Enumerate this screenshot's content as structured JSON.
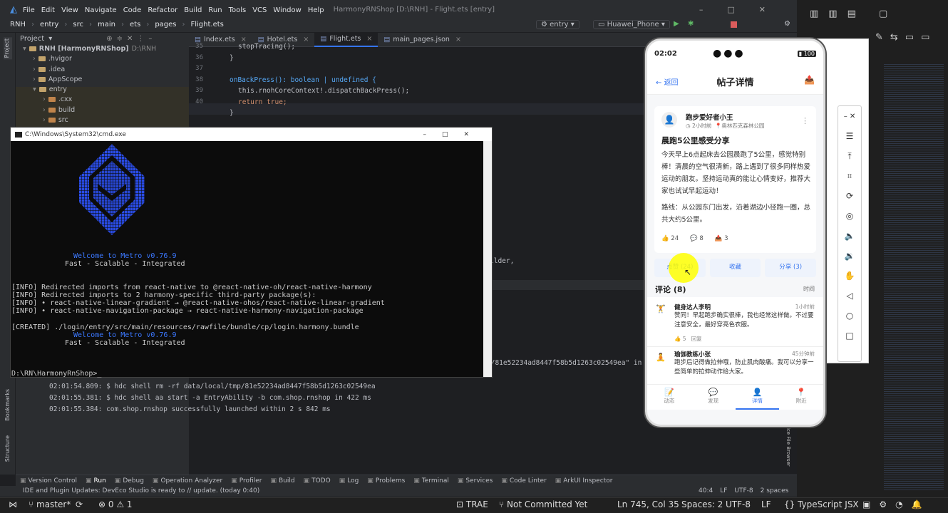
{
  "ide": {
    "title": "HarmonyRNShop [D:\\RNH] - Flight.ets [entry]",
    "menu": [
      "File",
      "Edit",
      "View",
      "Navigate",
      "Code",
      "Refactor",
      "Build",
      "Run",
      "Tools",
      "VCS",
      "Window",
      "Help"
    ],
    "breadcrumb": [
      "RNH",
      "entry",
      "src",
      "main",
      "ets",
      "pages",
      "Flight.ets"
    ],
    "run_config": "entry",
    "device": "Huawei_Phone",
    "project_label": "Project",
    "tree": [
      {
        "label": "RNH [HarmonyRNShop]",
        "extra": "D:\\RNH",
        "depth": 0
      },
      {
        "label": ".hvigor",
        "depth": 1
      },
      {
        "label": ".idea",
        "depth": 1
      },
      {
        "label": "AppScope",
        "depth": 1
      },
      {
        "label": "entry",
        "depth": 1
      },
      {
        "label": ".cxx",
        "depth": 2
      },
      {
        "label": "build",
        "depth": 2
      },
      {
        "label": "src",
        "depth": 2
      }
    ],
    "tabs": [
      "Index.ets",
      "Hotel.ets",
      "Flight.ets",
      "main_pages.json"
    ],
    "code_lines": [
      {
        "n": "35",
        "text": "stopTracing();"
      },
      {
        "n": "36",
        "text": "}"
      },
      {
        "n": "37",
        "text": ""
      },
      {
        "n": "38",
        "text": "onBackPress(): boolean | undefined {"
      },
      {
        "n": "39",
        "text": "this.rnohCoreContext!.dispatchBackPress();"
      },
      {
        "n": "40",
        "text": "return true;"
      },
      {
        "n": "41",
        "text": "}"
      }
    ],
    "right_snippet": "ilder,",
    "run_hash": "p/81e52234ad8447f58b5d1263c02549ea\" in",
    "run_log": [
      "02:01:54.809: $ hdc shell rm -rf data/local/tmp/81e52234ad8447f58b5d1263c02549ea",
      "02:01:55.381: $ hdc shell aa start -a EntryAbility -b com.shop.rnshop in 422 ms",
      "02:01:55.384: com.shop.rnshop successfully launched within 2 s 842 ms"
    ],
    "bottom_tabs": [
      "Version Control",
      "Run",
      "Debug",
      "Operation Analyzer",
      "Profiler",
      "Build",
      "TODO",
      "Log",
      "Problems",
      "Terminal",
      "Services",
      "Code Linter",
      "ArkUI Inspector"
    ],
    "status_msg": "IDE and Plugin Updates: DevEco Studio is ready to // update. (today 0:40)",
    "status_right": [
      "40:4",
      "LF",
      "UTF-8",
      "2 spaces"
    ],
    "side_labels": [
      "Bookmarks",
      "Structure"
    ],
    "file_browser": "ice File Browser"
  },
  "cmd": {
    "title": "C:\\Windows\\System32\\cmd.exe",
    "welcome": "Welcome to Metro v0.76.9",
    "tagline": "Fast - Scalable - Integrated",
    "lines": [
      "[INFO] Redirected imports from react-native to @react-native-oh/react-native-harmony",
      "[INFO] Redirected imports to 2 harmony-specific third-party package(s):",
      "[INFO] • react-native-linear-gradient → @react-native-ohos/react-native-linear-gradient",
      "[INFO] • react-native-navigation-package → react-native-harmony-navigation-package"
    ],
    "created": "[CREATED] ./login/entry/src/main/resources/rawfile/bundle/cp/login.harmony.bundle",
    "prompt": "D:\\RN\\HarmonyRnShop>"
  },
  "phone": {
    "time": "02:02",
    "battery": "100",
    "back": "返回",
    "title": "帖子详情",
    "author": "跑步爱好者小王",
    "time_ago": "2小时前",
    "location": "奥林匹克森林公园",
    "post_title": "晨跑5公里感受分享",
    "body": "今天早上6点起床去公园晨跑了5公里，感觉特别棒！清晨的空气很清新，路上遇到了很多同样热爱运动的朋友。坚持运动真的能让心情变好，推荐大家也试试早起运动！",
    "route": "路线：从公园东门出发，沿着湖边小径跑一圈，总共大约5公里。",
    "likes": "24",
    "comments": "8",
    "shares": "3",
    "btn_like": "点赞 (24)",
    "btn_fav": "收藏",
    "btn_share": "分享 (3)",
    "comments_title": "评论 (8)",
    "sort": "时间",
    "comment_list": [
      {
        "name": "健身达人李明",
        "time": "1小时前",
        "text": "赞同！早起跑步确实很棒，我也经常这样做。不过要注意安全，最好穿亮色衣服。",
        "likes": "5",
        "reply": "回复"
      },
      {
        "name": "瑜伽教练小张",
        "time": "45分钟前",
        "text": "跑步后记得做拉伸哦，防止肌肉酸痛。我可以分享一些简单的拉伸动作给大家。"
      }
    ],
    "nav": [
      "动态",
      "发现",
      "详情",
      "附近"
    ]
  },
  "taskbar": {
    "branch": "master*",
    "errors": "0",
    "warnings": "1",
    "trae": "TRAE",
    "vcs": "Not Committed Yet",
    "pos": "Ln 745, Col 35",
    "spaces": "Spaces: 2",
    "enc": "UTF-8",
    "eol": "LF",
    "lang": "TypeScript JSX"
  },
  "colors": {
    "accent": "#3574f0",
    "highlight": "#ffff00",
    "metro_blue": "#1e46d8"
  }
}
